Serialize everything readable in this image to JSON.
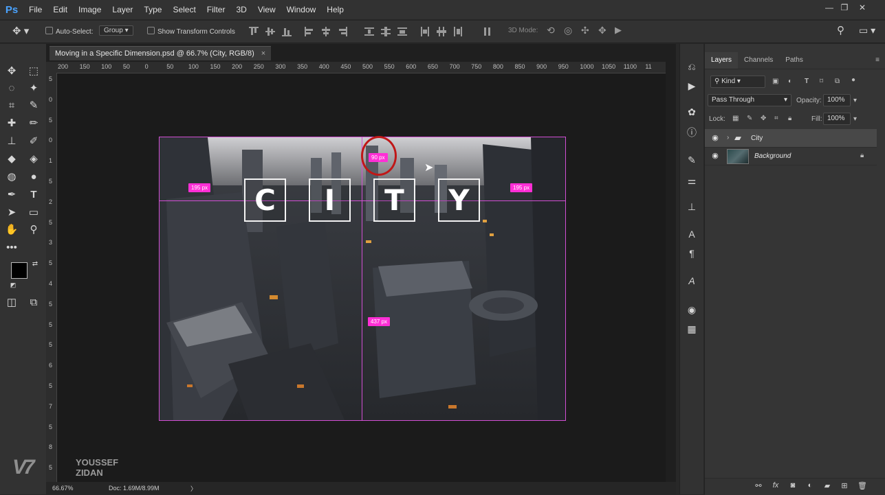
{
  "app": {
    "logo": "Ps"
  },
  "menu": [
    "File",
    "Edit",
    "Image",
    "Layer",
    "Type",
    "Select",
    "Filter",
    "3D",
    "View",
    "Window",
    "Help"
  ],
  "window_controls": {
    "minimize": "—",
    "restore": "❐",
    "close": "✕"
  },
  "options_bar": {
    "auto_select_label": "Auto-Select:",
    "auto_select_value": "Group",
    "show_transform_label": "Show Transform Controls",
    "mode_3d_label": "3D Mode:"
  },
  "document": {
    "tab_title": "Moving in a Specific Dimension.psd @ 66.7% (City, RGB/8)",
    "tab_close": "×",
    "ruler_h": [
      "200",
      "150",
      "100",
      "50",
      "0",
      "50",
      "100",
      "150",
      "200",
      "250",
      "300",
      "350",
      "400",
      "450",
      "500",
      "550",
      "600",
      "650",
      "700",
      "750",
      "800",
      "850",
      "900",
      "950",
      "1000",
      "1050",
      "1100",
      "11"
    ],
    "ruler_v": [
      "5",
      "0",
      "5",
      "0",
      "1",
      "5",
      "2",
      "5",
      "3",
      "5",
      "4",
      "5",
      "5",
      "5",
      "6",
      "5",
      "7",
      "5",
      "8",
      "5"
    ],
    "letters": [
      "C",
      "I",
      "T",
      "Y"
    ],
    "measurements": {
      "top": "90 px",
      "left": "195 px",
      "right": "195 px",
      "bottom": "437 px"
    }
  },
  "status": {
    "zoom": "66.67%",
    "doc": "Doc: 1.69M/8.99M",
    "arrow": "〉"
  },
  "layers_panel": {
    "tabs": [
      "Layers",
      "Channels",
      "Paths"
    ],
    "filter": "Kind",
    "blend_mode": "Pass Through",
    "opacity_label": "Opacity:",
    "opacity_value": "100%",
    "lock_label": "Lock:",
    "fill_label": "Fill:",
    "fill_value": "100%",
    "layers": [
      {
        "name": "City",
        "type": "group",
        "visible": true,
        "selected": true
      },
      {
        "name": "Background",
        "type": "image",
        "visible": true,
        "locked": true
      }
    ],
    "footer_icons": [
      "link-icon",
      "fx-icon",
      "mask-icon",
      "adjustment-icon",
      "group-icon",
      "new-layer-icon",
      "trash-icon"
    ],
    "footer_fx": "fx"
  },
  "watermark": {
    "line1": "YOUSSEF",
    "line2": "ZIDAN",
    "mark": "V7"
  },
  "colors": {
    "accent": "#ff2fd6",
    "guide": "#d44fd6",
    "highlight": "#c01717",
    "logo": "#4aa3ff"
  }
}
